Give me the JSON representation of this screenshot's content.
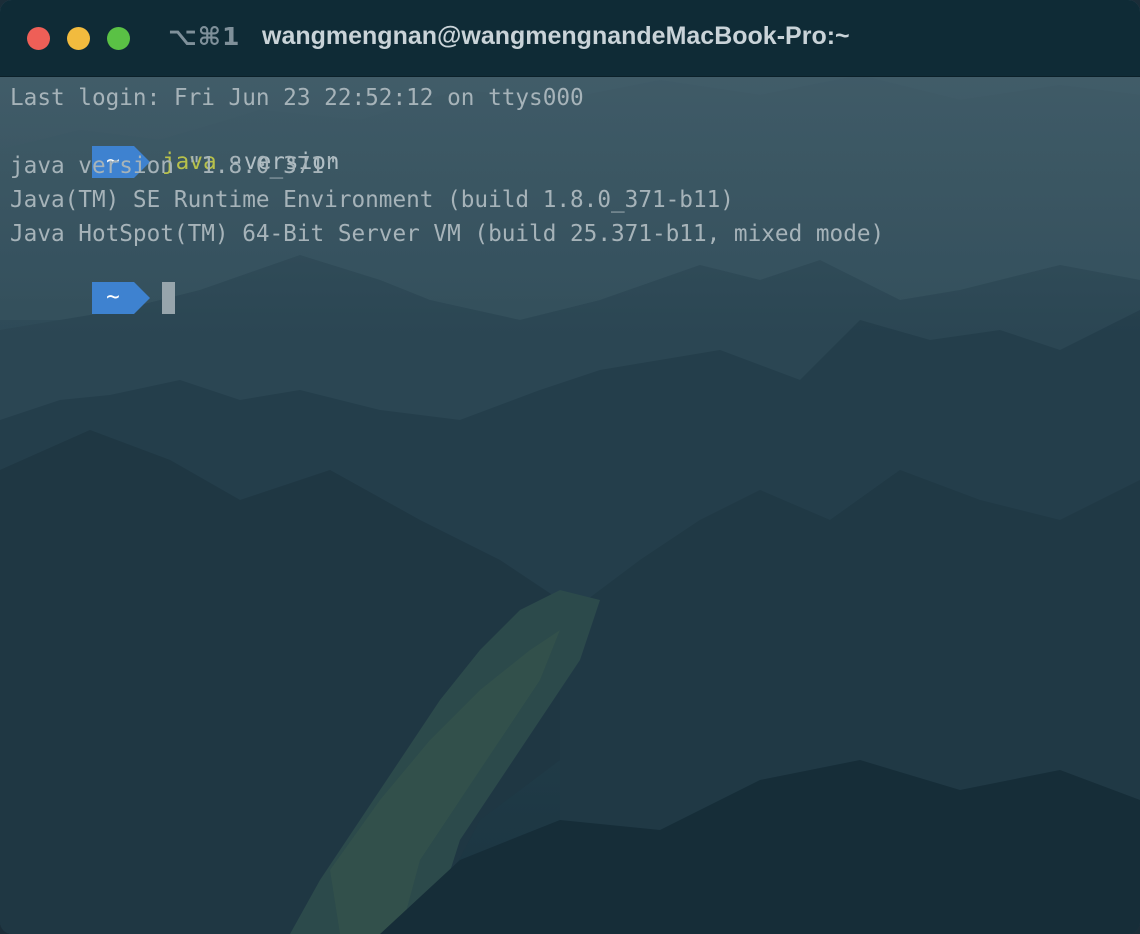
{
  "window": {
    "shortcut": "⌥⌘1",
    "title": "wangmengnan@wangmengnandeMacBook-Pro:~"
  },
  "terminal": {
    "last_login": "Last login: Fri Jun 23 22:52:12 on ttys000",
    "prompt_dir": "~",
    "command": "java",
    "command_args": " -version",
    "output": [
      "java version \"1.8.0_371\"",
      "Java(TM) SE Runtime Environment (build 1.8.0_371-b11)",
      "Java HotSpot(TM) 64-Bit Server VM (build 25.371-b11, mixed mode)"
    ],
    "prompt_dir_2": "~"
  },
  "theme": {
    "titlebar_bg": "#0f2b36",
    "prompt_badge": "#3e82d0",
    "command_color": "#b8c14b",
    "text_color": "#a6b3b9",
    "traffic_lights": {
      "close": "#ee5f57",
      "minimize": "#f2bb3e",
      "zoom": "#5ac145"
    }
  }
}
